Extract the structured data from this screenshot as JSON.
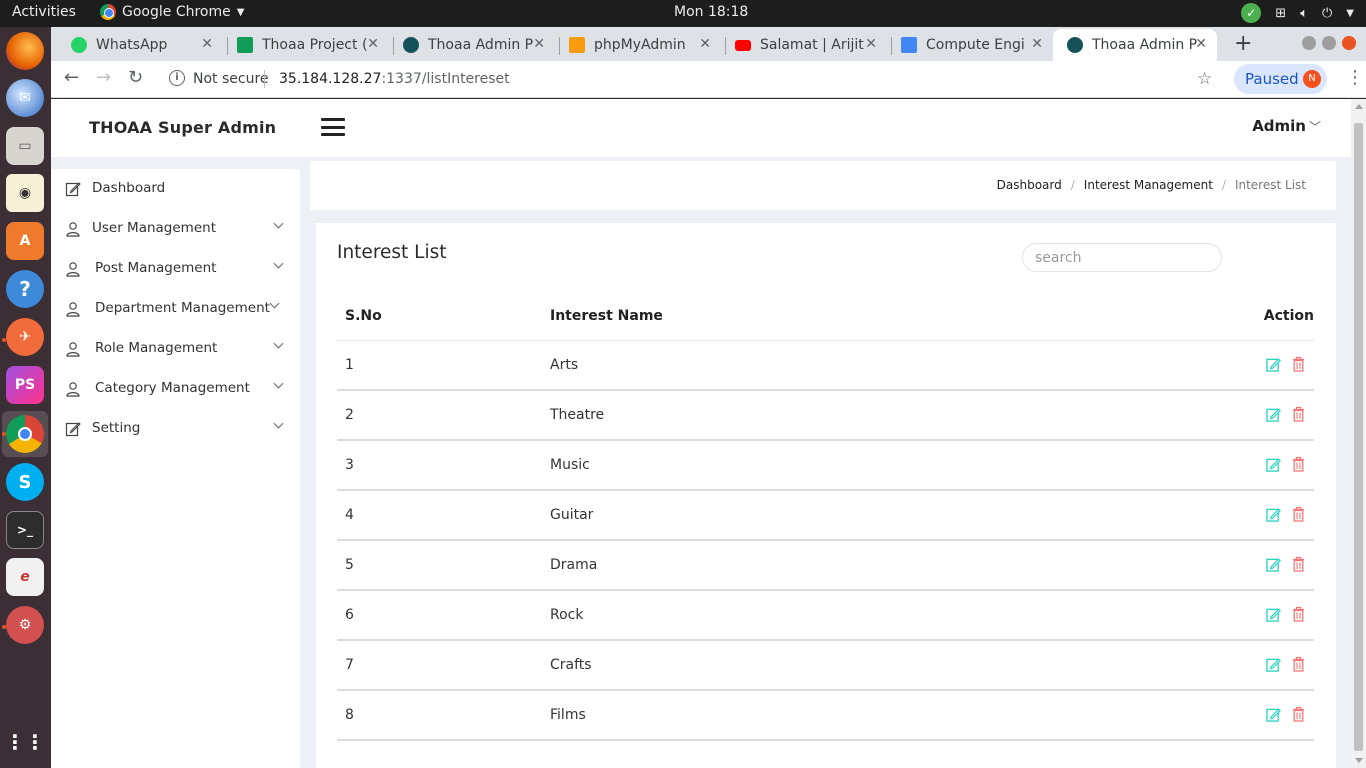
{
  "os": {
    "activities": "Activities",
    "app_menu": "Google Chrome",
    "clock": "Mon 18:18"
  },
  "browser": {
    "tabs": [
      {
        "label": "WhatsApp",
        "color": "#25d366"
      },
      {
        "label": "Thoaa Project (",
        "color": "#0f9d58"
      },
      {
        "label": "Thoaa Admin P",
        "color": "#16525a"
      },
      {
        "label": "phpMyAdmin",
        "color": "#f89c0e"
      },
      {
        "label": "Salamat | Arijit",
        "color": "#ff0000"
      },
      {
        "label": "Compute Engi",
        "color": "#4285f4"
      },
      {
        "label": "Thoaa Admin P",
        "color": "#16525a"
      }
    ],
    "active_tab_index": 6,
    "url_security": "Not secure",
    "url_host": "35.184.128.27",
    "url_rest": ":1337/listIntereset",
    "profile_status": "Paused",
    "profile_initial": "N"
  },
  "app": {
    "brand": "THOAA Super Admin",
    "user_menu": "Admin"
  },
  "sidebar": {
    "items": [
      {
        "label": "Dashboard",
        "icon": "edit-icon",
        "expandable": false
      },
      {
        "label": "User Management",
        "icon": "user-icon",
        "expandable": true
      },
      {
        "label": "Post Management",
        "icon": "user-icon",
        "expandable": true
      },
      {
        "label": "Department Management",
        "icon": "user-icon",
        "expandable": true
      },
      {
        "label": "Role Management",
        "icon": "user-icon",
        "expandable": true
      },
      {
        "label": "Category Management",
        "icon": "user-icon",
        "expandable": true
      },
      {
        "label": "Setting",
        "icon": "edit-icon",
        "expandable": true
      }
    ]
  },
  "breadcrumb": {
    "items": [
      "Dashboard",
      "Interest Management",
      "Interest List"
    ]
  },
  "main": {
    "title": "Interest List",
    "search_placeholder": "search",
    "columns": [
      "S.No",
      "Interest Name",
      "Action"
    ],
    "rows": [
      {
        "sno": "1",
        "name": "Arts"
      },
      {
        "sno": "2",
        "name": "Theatre"
      },
      {
        "sno": "3",
        "name": "Music"
      },
      {
        "sno": "4",
        "name": "Guitar"
      },
      {
        "sno": "5",
        "name": "Drama"
      },
      {
        "sno": "6",
        "name": "Rock"
      },
      {
        "sno": "7",
        "name": "Crafts"
      },
      {
        "sno": "8",
        "name": "Films"
      }
    ],
    "edit_color": "#2bd3c1",
    "delete_color": "#f4777a"
  }
}
